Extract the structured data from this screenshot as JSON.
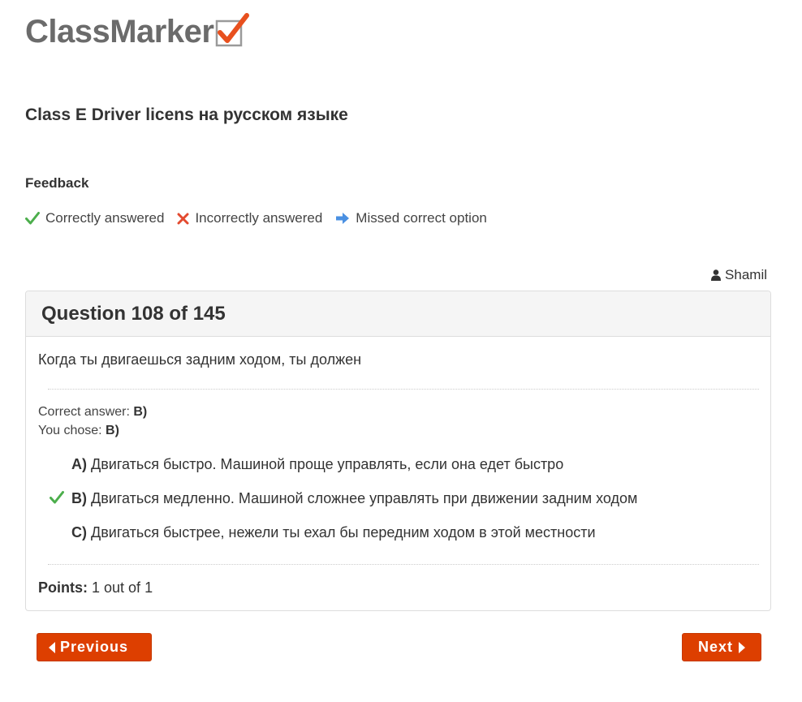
{
  "logo": {
    "text": "ClassMarker",
    "icon": "checkbox-check-icon"
  },
  "test_title": "Class E Driver licens на русском языке",
  "feedback": {
    "heading": "Feedback",
    "legend": [
      {
        "icon": "check-icon",
        "label": "Correctly answered",
        "color": "#4cae4c"
      },
      {
        "icon": "cross-icon",
        "label": "Incorrectly answered",
        "color": "#e34a2f"
      },
      {
        "icon": "arrow-right-icon",
        "label": "Missed correct option",
        "color": "#4a90e2"
      }
    ]
  },
  "user": {
    "icon": "user-icon",
    "name": "Shamil"
  },
  "question": {
    "heading": "Question 108 of 145",
    "text": "Когда ты двигаешься задним ходом, ты должен",
    "correct_answer_label": "Correct answer:",
    "correct_answer": "B)",
    "you_chose_label": "You chose:",
    "you_chose": "B)",
    "options": [
      {
        "letter": "A)",
        "text": "Двигаться быстро. Машиной проще управлять, если она едет быстро",
        "mark": ""
      },
      {
        "letter": "B)",
        "text": "Двигаться медленно. Машиной сложнее управлять при движении задним ходом",
        "mark": "check-icon"
      },
      {
        "letter": "C)",
        "text": "Двигаться быстрее, нежели ты ехал бы передним ходом в этой местности",
        "mark": ""
      }
    ],
    "points_label": "Points:",
    "points_value": "1 out of 1"
  },
  "nav": {
    "previous_label": "Previous",
    "next_label": "Next"
  },
  "colors": {
    "button": "#dd3f00",
    "logo_check": "#e8501e",
    "check": "#4cae4c"
  }
}
